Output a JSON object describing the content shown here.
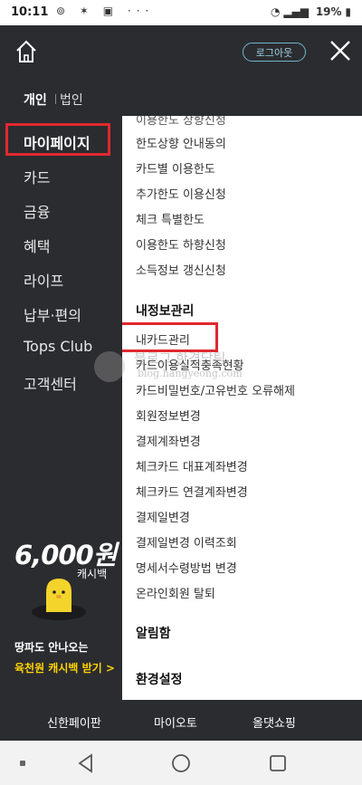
{
  "status_bar": {
    "time": "10:11",
    "battery": "19%"
  },
  "topbar": {
    "logout_label": "로그아웃"
  },
  "tabs": {
    "personal": "개인",
    "business": "법인"
  },
  "sidebar": {
    "items": [
      {
        "label": "마이페이지"
      },
      {
        "label": "카드"
      },
      {
        "label": "금융"
      },
      {
        "label": "혜택"
      },
      {
        "label": "라이프"
      },
      {
        "label": "납부·편의"
      },
      {
        "label": "Tops Club"
      },
      {
        "label": "고객센터"
      }
    ],
    "promo": {
      "amount": "6,000원",
      "cashback": "캐시백",
      "line1": "땅파도 안나오는",
      "line2": "육천원 캐시백 받기 >"
    }
  },
  "main": {
    "partial_item": "이용한도 상향신청",
    "limit_items": [
      "한도상향 안내동의",
      "카드별 이용한도",
      "추가한도 이용신청",
      "체크 특별한도",
      "이용한도 하향신청",
      "소득정보 갱신신청"
    ],
    "section_personal": "내정보관리",
    "personal_items": [
      "내카드관리",
      "카드이용실적충족현황",
      "카드비밀번호/고유번호 오류해제",
      "회원정보변경",
      "결제계좌변경",
      "체크카드 대표계좌변경",
      "체크카드 연결계좌변경",
      "결제일변경",
      "결제일변경 이력조회",
      "명세서수령방법 변경",
      "온라인회원 탈퇴"
    ],
    "section_notice": "알림함",
    "section_settings": "환경설정",
    "watermark": "블로그 한경담팀",
    "watermark_url": "blog.hangyeong.com"
  },
  "bottom_nav": {
    "items": [
      "신한페이판",
      "마이오토",
      "올댓쇼핑"
    ]
  },
  "colors": {
    "sidebar_bg": "#2b2c30",
    "highlight_red": "#e0282e",
    "logout_border": "#6fb7c9",
    "promo_yellow": "#ffd400"
  }
}
